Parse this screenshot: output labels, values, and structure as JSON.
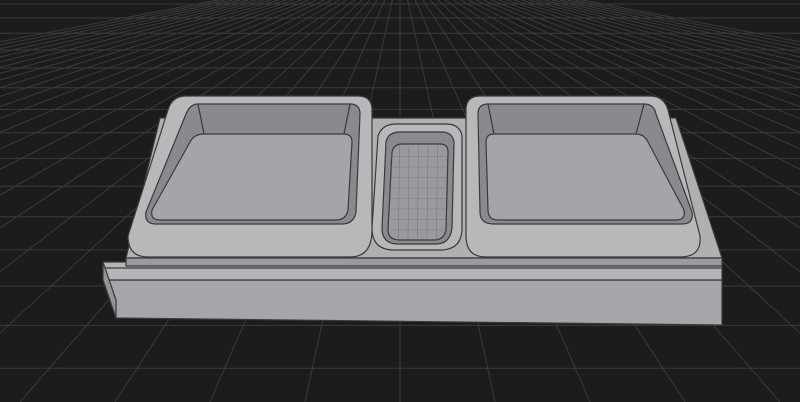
{
  "viewport": {
    "background_color": "#1c1c1c",
    "grid_color": "#3a3a3a",
    "grid_major_color": "#444444"
  },
  "model": {
    "object": "tray-with-two-square-compartments-and-center-slot",
    "body_color": "#a9a9ad",
    "face_color": "#9e9ea2",
    "shadow_color": "#7e7e82",
    "floor_color": "#a6a6aa",
    "edge_color": "#3a3a3c",
    "center_mesh_color": "#8f8f93"
  }
}
